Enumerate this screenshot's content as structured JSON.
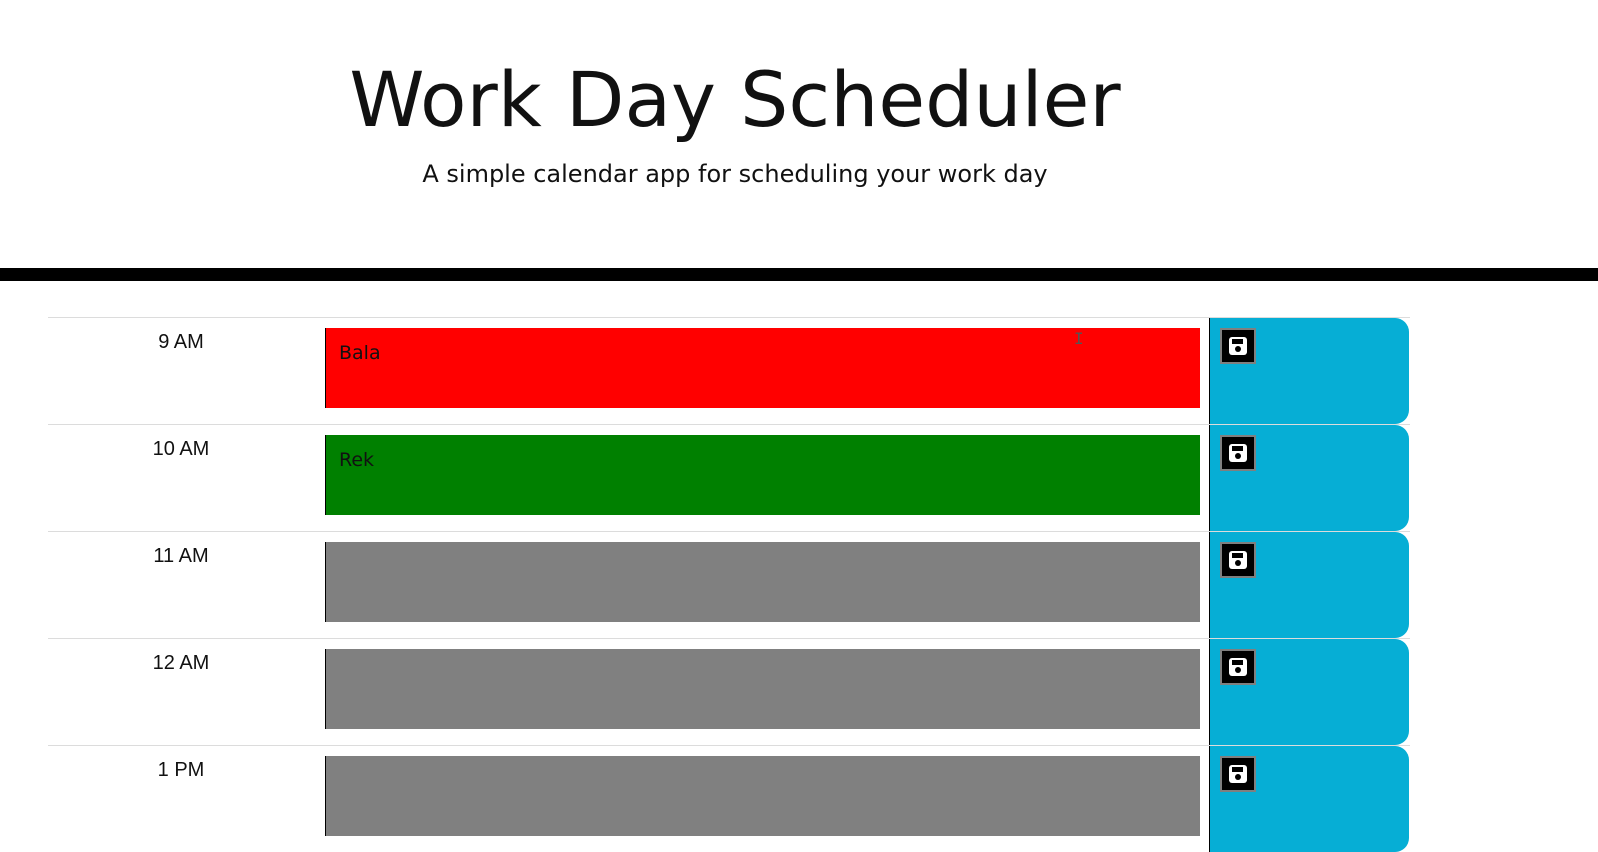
{
  "header": {
    "title": "Work Day Scheduler",
    "subtitle": "A simple calendar app for scheduling your work day"
  },
  "colors": {
    "past": "#ff0000",
    "present": "#008000",
    "future": "#808080",
    "save": "#06aed5",
    "divider": "#000000"
  },
  "rows": [
    {
      "hour": "9 AM",
      "text": "Bala",
      "state": "past",
      "save_icon": "floppy-disk-icon"
    },
    {
      "hour": "10 AM",
      "text": "Rek",
      "state": "present",
      "save_icon": "floppy-disk-icon"
    },
    {
      "hour": "11 AM",
      "text": "",
      "state": "future",
      "save_icon": "floppy-disk-icon"
    },
    {
      "hour": "12 AM",
      "text": "",
      "state": "future",
      "save_icon": "floppy-disk-icon"
    },
    {
      "hour": "1 PM",
      "text": "",
      "state": "future",
      "save_icon": "floppy-disk-icon"
    }
  ]
}
